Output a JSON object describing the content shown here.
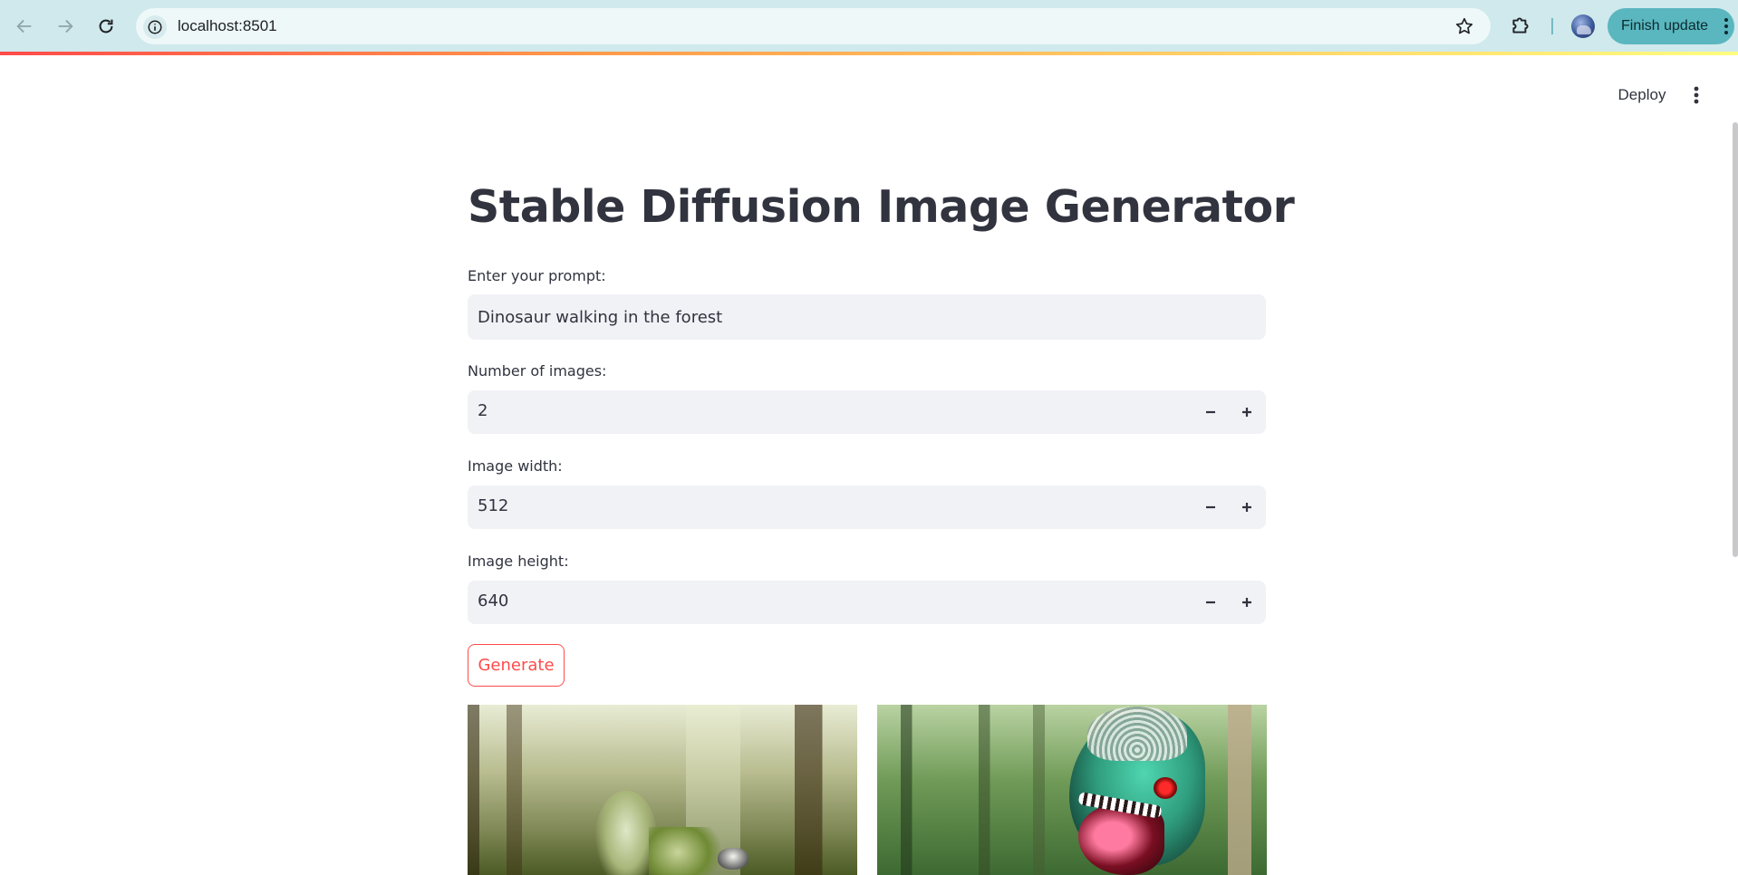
{
  "browser": {
    "url": "localhost:8501",
    "finish_update_label": "Finish update"
  },
  "app": {
    "deploy_label": "Deploy",
    "title": "Stable Diffusion Image Generator"
  },
  "form": {
    "prompt": {
      "label": "Enter your prompt:",
      "value": "Dinosaur walking in the forest"
    },
    "num_images": {
      "label": "Number of images:",
      "value": "2"
    },
    "width": {
      "label": "Image width:",
      "value": "512"
    },
    "height": {
      "label": "Image height:",
      "value": "640"
    },
    "generate_label": "Generate"
  },
  "colors": {
    "accent": "#ff4b4b",
    "input_bg": "#f0f2f6",
    "text": "#31333f",
    "chrome_bg": "#cfe9ec"
  },
  "icons": {
    "back": "arrow-left-icon",
    "forward": "arrow-right-icon",
    "reload": "reload-icon",
    "site_info": "info-icon",
    "bookmark": "star-icon",
    "extensions": "puzzle-icon",
    "menu": "kebab-icon",
    "decrement": "minus-icon",
    "increment": "plus-icon"
  }
}
